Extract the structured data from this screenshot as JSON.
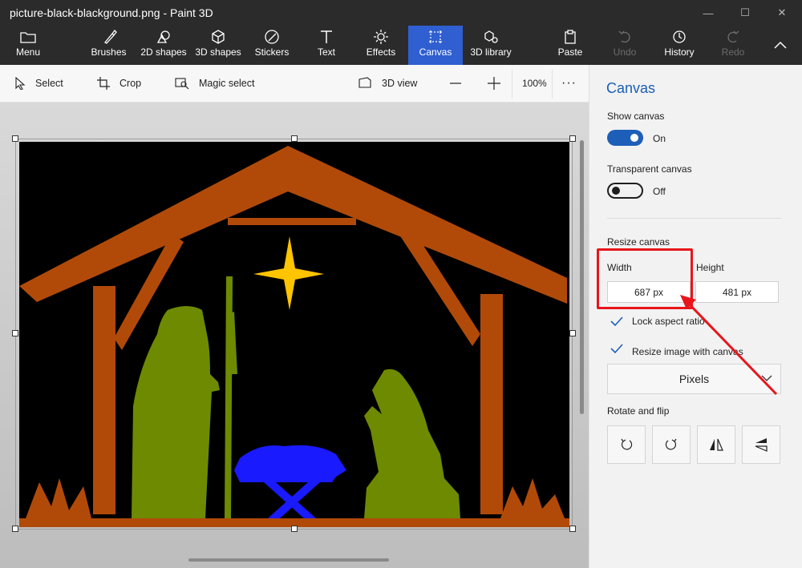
{
  "window": {
    "title": "picture-black-blackground.png - Paint 3D"
  },
  "ribbon": {
    "menu": "Menu",
    "brushes": "Brushes",
    "shapes2d": "2D shapes",
    "shapes3d": "3D shapes",
    "stickers": "Stickers",
    "text": "Text",
    "effects": "Effects",
    "canvas": "Canvas",
    "library3d": "3D library",
    "paste": "Paste",
    "undo": "Undo",
    "history": "History",
    "redo": "Redo",
    "active_color": "#2f5fd0"
  },
  "toolbar": {
    "select": "Select",
    "crop": "Crop",
    "magic_select": "Magic select",
    "view3d": "3D view",
    "zoom": "100%"
  },
  "panel": {
    "title": "Canvas",
    "show_canvas_label": "Show canvas",
    "show_canvas_state": "On",
    "transparent_label": "Transparent canvas",
    "transparent_state": "Off",
    "resize_label": "Resize canvas",
    "width_label": "Width",
    "height_label": "Height",
    "width_value": "687 px",
    "height_value": "481 px",
    "lock_aspect": "Lock aspect ratio",
    "resize_image": "Resize image with canvas",
    "units": "Pixels",
    "rotate_label": "Rotate and flip",
    "accent_color": "#1d5fb8"
  },
  "icons": [
    "folder-icon",
    "brush-icon",
    "shapes-2d-icon",
    "cube-icon",
    "sticker-icon",
    "text-icon",
    "sun-icon",
    "crop-icon",
    "library-icon",
    "paste-icon",
    "undo-icon",
    "history-icon",
    "redo-icon",
    "select-arrow-icon",
    "magic-select-icon",
    "view-3d-icon",
    "rotate-left-icon",
    "rotate-right-icon",
    "flip-vertical-icon",
    "flip-horizontal-icon"
  ],
  "annotation_color": "#e8151a"
}
